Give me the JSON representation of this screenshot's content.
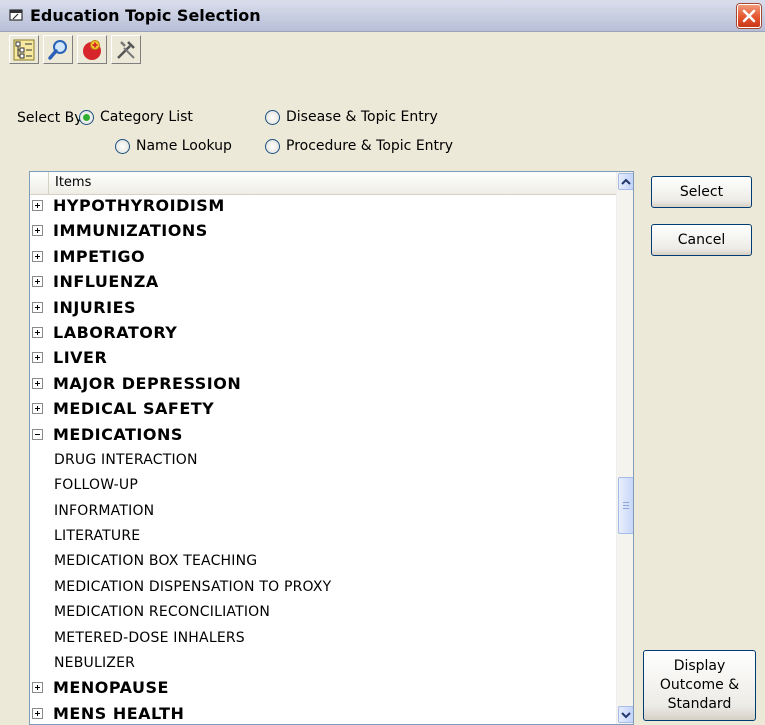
{
  "window": {
    "title": "Education Topic Selection"
  },
  "toolbar": {
    "buttons": [
      {
        "icon": "tree-view-icon"
      },
      {
        "icon": "magnifier-icon"
      },
      {
        "icon": "medical-cross-icon"
      },
      {
        "icon": "tools-icon"
      }
    ]
  },
  "select_by": {
    "label": "Select By",
    "options": [
      {
        "label": "Category List",
        "selected": true
      },
      {
        "label": "Disease & Topic Entry",
        "selected": false
      },
      {
        "label": "Name Lookup",
        "selected": false
      },
      {
        "label": "Procedure & Topic Entry",
        "selected": false
      }
    ]
  },
  "list": {
    "header": "Items",
    "items": [
      {
        "label": "HYPOTHYROIDISM",
        "type": "category",
        "expanded": false
      },
      {
        "label": "IMMUNIZATIONS",
        "type": "category",
        "expanded": false
      },
      {
        "label": "IMPETIGO",
        "type": "category",
        "expanded": false
      },
      {
        "label": "INFLUENZA",
        "type": "category",
        "expanded": false
      },
      {
        "label": "INJURIES",
        "type": "category",
        "expanded": false
      },
      {
        "label": "LABORATORY",
        "type": "category",
        "expanded": false
      },
      {
        "label": "LIVER",
        "type": "category",
        "expanded": false
      },
      {
        "label": "MAJOR DEPRESSION",
        "type": "category",
        "expanded": false
      },
      {
        "label": "MEDICAL SAFETY",
        "type": "category",
        "expanded": false
      },
      {
        "label": "MEDICATIONS",
        "type": "category",
        "expanded": true
      },
      {
        "label": "DRUG INTERACTION",
        "type": "child"
      },
      {
        "label": "FOLLOW-UP",
        "type": "child"
      },
      {
        "label": "INFORMATION",
        "type": "child"
      },
      {
        "label": "LITERATURE",
        "type": "child"
      },
      {
        "label": "MEDICATION BOX TEACHING",
        "type": "child"
      },
      {
        "label": "MEDICATION DISPENSATION TO PROXY",
        "type": "child"
      },
      {
        "label": "MEDICATION RECONCILIATION",
        "type": "child"
      },
      {
        "label": "METERED-DOSE INHALERS",
        "type": "child"
      },
      {
        "label": "NEBULIZER",
        "type": "child"
      },
      {
        "label": "MENOPAUSE",
        "type": "category",
        "expanded": false
      },
      {
        "label": "MENS HEALTH",
        "type": "category",
        "expanded": false
      }
    ]
  },
  "buttons": {
    "select": "Select",
    "cancel": "Cancel",
    "display_line1": "Display",
    "display_line2": "Outcome &",
    "display_line3": "Standard"
  }
}
